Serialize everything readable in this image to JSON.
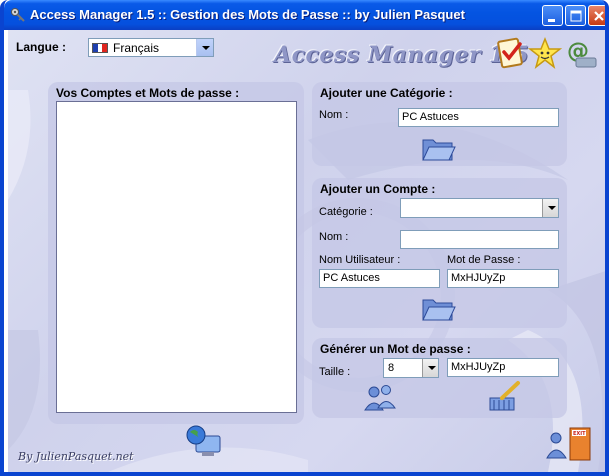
{
  "window": {
    "title": "Access Manager 1.5 :: Gestion des Mots de Passe :: by Julien Pasquet"
  },
  "language": {
    "label": "Langue :",
    "selected": "Français",
    "flag_colors": [
      "#1f3fae",
      "#ffffff",
      "#e0261f"
    ]
  },
  "brand": "Access Manager 1.5",
  "accounts_panel": {
    "title": "Vos Comptes et Mots de passe :",
    "items": []
  },
  "add_category": {
    "title": "Ajouter une Catégorie :",
    "name_label": "Nom :",
    "name_value": "PC Astuces"
  },
  "add_account": {
    "title": "Ajouter un Compte :",
    "category_label": "Catégorie :",
    "category_value": "",
    "name_label": "Nom :",
    "name_value": "",
    "username_label": "Nom Utilisateur :",
    "username_value": "PC Astuces",
    "password_label": "Mot de Passe :",
    "password_value": "MxHJUyZp"
  },
  "generate_password": {
    "title": "Générer un Mot de passe :",
    "size_label": "Taille :",
    "size_value": "8",
    "generated_value": "MxHJUyZp"
  },
  "footer": {
    "credit": "By JulienPasquet.net"
  },
  "colors": {
    "titlebar": "#0454e1",
    "background": "#d6d8f0",
    "panel": "#c4c7e6"
  }
}
